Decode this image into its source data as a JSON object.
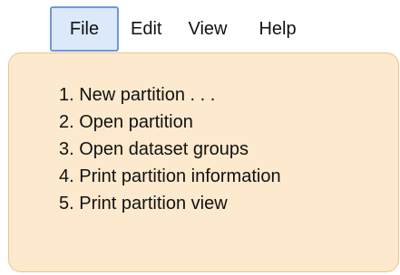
{
  "menubar": {
    "items": [
      {
        "label": "File"
      },
      {
        "label": "Edit"
      },
      {
        "label": "View"
      },
      {
        "label": "Help"
      }
    ]
  },
  "file_menu": {
    "items": [
      {
        "label": "1.  New partition . . ."
      },
      {
        "label": "2.  Open partition"
      },
      {
        "label": "3.  Open dataset groups"
      },
      {
        "label": "4.  Print partition information"
      },
      {
        "label": "5.  Print partition view"
      }
    ]
  },
  "colors": {
    "active_menu_bg": "#dbe9fa",
    "active_menu_border": "#6f97d6",
    "dropdown_bg": "#fde9cd",
    "dropdown_border": "#e9c58e"
  }
}
